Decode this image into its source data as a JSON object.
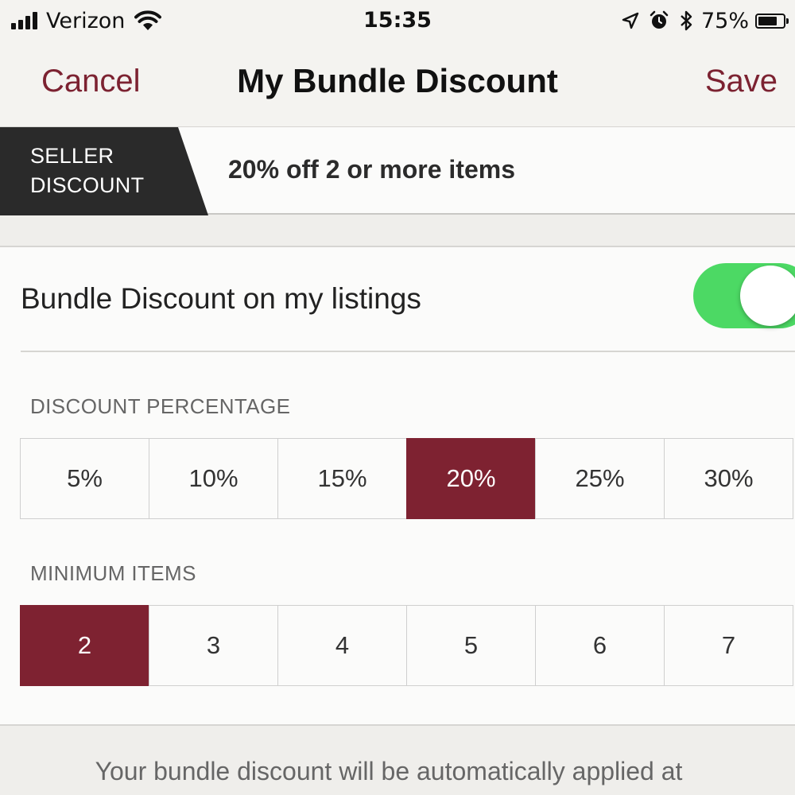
{
  "status_bar": {
    "carrier": "Verizon",
    "time": "15:35",
    "battery": "75%",
    "battery_level": 0.75,
    "icons": [
      "signal-icon",
      "wifi-icon",
      "location-icon",
      "alarm-icon",
      "bluetooth-icon",
      "battery-icon"
    ]
  },
  "nav": {
    "cancel_label": "Cancel",
    "title": "My Bundle Discount",
    "save_label": "Save"
  },
  "summary": {
    "badge_line1": "SELLER",
    "badge_line2": "DISCOUNT",
    "text": "20% off 2 or more items"
  },
  "settings": {
    "toggle_label": "Bundle Discount on my listings",
    "toggle_on": true,
    "discount_label": "DISCOUNT PERCENTAGE",
    "discount_options": [
      "5%",
      "10%",
      "15%",
      "20%",
      "25%",
      "30%"
    ],
    "discount_selected": "20%",
    "min_items_label": "MINIMUM ITEMS",
    "min_items_options": [
      "2",
      "3",
      "4",
      "5",
      "6",
      "7"
    ],
    "min_items_selected": "2"
  },
  "footer": {
    "text": "Your bundle discount will be automatically applied at"
  },
  "colors": {
    "accent": "#7e2231",
    "toggle_on": "#4cd964",
    "badge_bg": "#2a2a2a"
  }
}
